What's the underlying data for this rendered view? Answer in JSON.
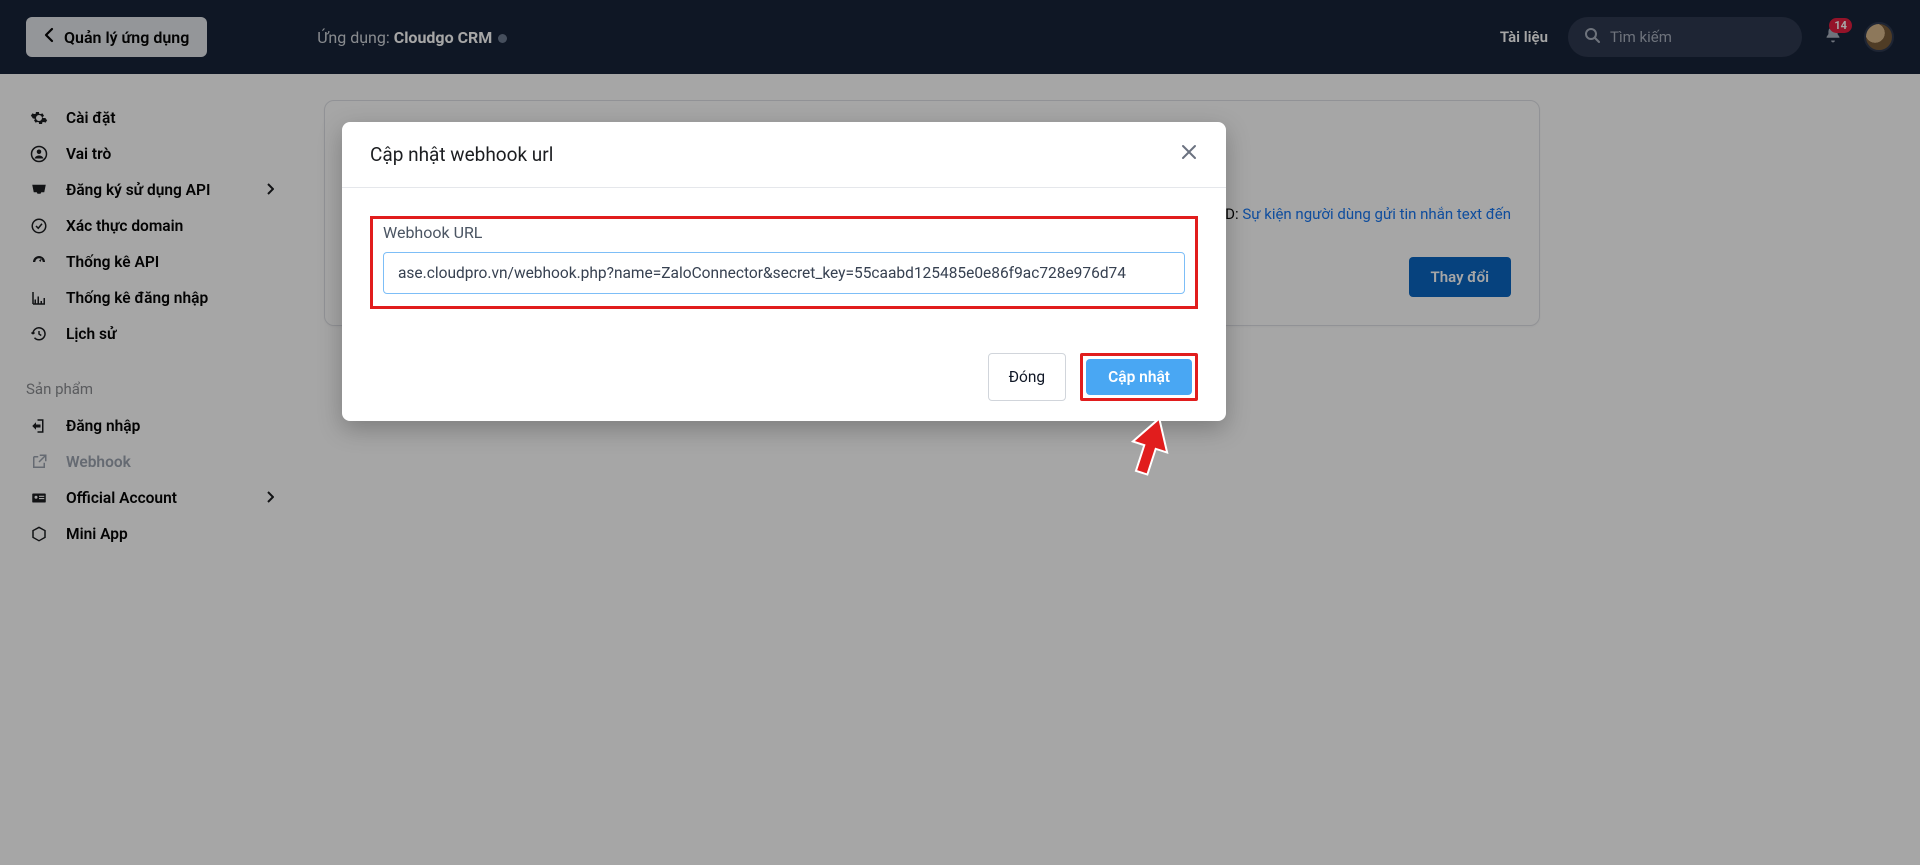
{
  "header": {
    "back_label": "Quản lý ứng dụng",
    "app_prefix": "Ứng dụng: ",
    "app_name": "Cloudgo CRM",
    "docs_label": "Tài liệu",
    "search_placeholder": "Tìm kiếm",
    "notification_count": "14"
  },
  "sidebar": {
    "items": [
      {
        "icon": "gear",
        "label": "Cài đặt",
        "chevron": false
      },
      {
        "icon": "user",
        "label": "Vai trò",
        "chevron": false
      },
      {
        "icon": "inbox",
        "label": "Đăng ký sử dụng API",
        "chevron": true
      },
      {
        "icon": "check",
        "label": "Xác thực domain",
        "chevron": false
      },
      {
        "icon": "gauge",
        "label": "Thống kê API",
        "chevron": false
      },
      {
        "icon": "chart",
        "label": "Thống kê đăng nhập",
        "chevron": false
      },
      {
        "icon": "history",
        "label": "Lịch sử",
        "chevron": false
      }
    ],
    "section_label": "Sản phẩm",
    "product_items": [
      {
        "icon": "login",
        "label": "Đăng nhập",
        "muted": false,
        "chevron": false
      },
      {
        "icon": "external",
        "label": "Webhook",
        "muted": true,
        "chevron": false
      },
      {
        "icon": "card",
        "label": "Official Account",
        "muted": false,
        "chevron": true
      },
      {
        "icon": "cube",
        "label": "Mini App",
        "muted": false,
        "chevron": false
      }
    ]
  },
  "panel": {
    "right_text_prefix": "D: ",
    "right_link": "Sự kiện người dùng gửi tin nhắn text đến",
    "change_button": "Thay đổi"
  },
  "modal": {
    "title": "Cập nhật webhook url",
    "field_label": "Webhook URL",
    "url_value": "ase.cloudpro.vn/webhook.php?name=ZaloConnector&secret_key=55caabd125485e0e86f9ac728e976d74",
    "close_label": "Đóng",
    "update_label": "Cập nhật"
  }
}
